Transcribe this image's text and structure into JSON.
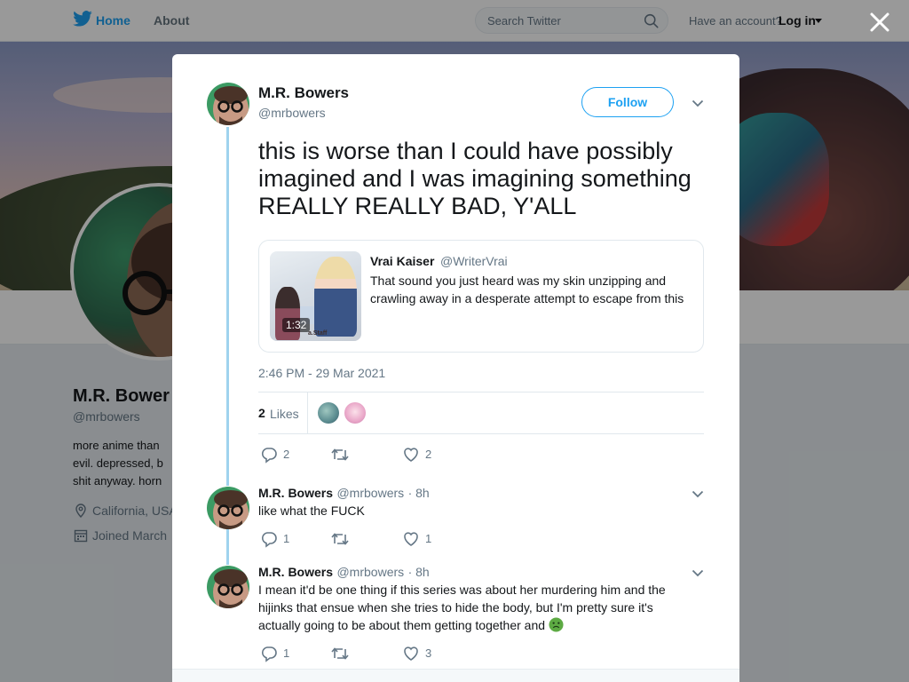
{
  "nav": {
    "home_label": "Home",
    "about_label": "About",
    "search_placeholder": "Search Twitter",
    "account_text": "Have an account?",
    "login_label": "Log in"
  },
  "profile": {
    "name": "M.R. Bower",
    "handle": "@mrbowers",
    "bio": "more anime than\nevil. depressed, b\nshit anyway. horn",
    "location": "California, USA",
    "joined": "Joined March"
  },
  "colors": {
    "accent": "#1da1f2",
    "thread_line": "#9fd3ee",
    "text": "#14171a",
    "muted": "#657786"
  },
  "tweet": {
    "name": "M.R. Bowers",
    "handle": "@mrbowers",
    "follow_label": "Follow",
    "text": "this is worse than I could have possibly imagined and I was imagining something REALLY REALLY BAD, Y'ALL",
    "quote": {
      "name": "Vrai Kaiser",
      "handle": "@WriterVrai",
      "text": "That sound you just heard was my skin unzipping and crawling away in a desperate attempt to escape from this",
      "video_duration": "1:32",
      "watermark": "a.Staff"
    },
    "timestamp": "2:46 PM - 29 Mar 2021",
    "likes_count": "2",
    "likes_label": "Likes",
    "actions": {
      "replies": "2",
      "retweets": "",
      "likes": "2"
    }
  },
  "replies": [
    {
      "name": "M.R. Bowers",
      "handle": "@mrbowers",
      "time": "· 8h",
      "text": "like what the FUCK",
      "replies": "1",
      "likes": "1"
    },
    {
      "name": "M.R. Bowers",
      "handle": "@mrbowers",
      "time": "· 8h",
      "text": "I mean it'd be one thing if this series was about her murdering him and the hijinks that ensue when she tries to hide the body, but I'm pretty sure it's actually going to be about them getting together and",
      "emoji": "nauseated-face-emoji",
      "replies": "1",
      "likes": "3"
    }
  ],
  "icons": [
    "twitter-bird-icon",
    "search-icon",
    "caret-down-icon",
    "close-icon",
    "chevron-down-icon",
    "reply-icon",
    "retweet-icon",
    "like-icon",
    "location-pin-icon",
    "calendar-icon"
  ]
}
